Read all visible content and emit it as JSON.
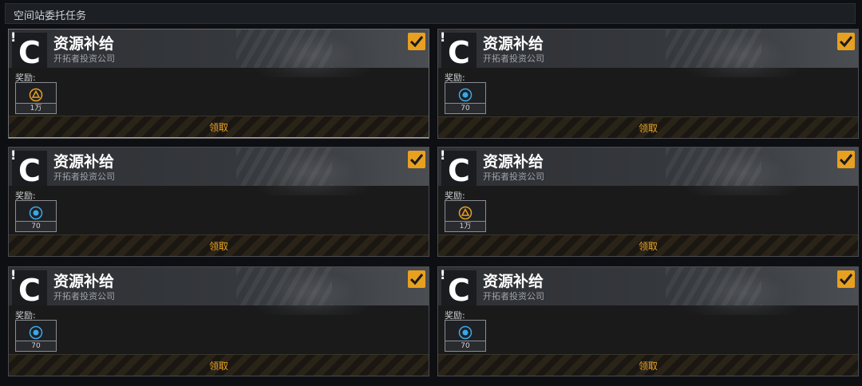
{
  "window": {
    "title": "空间站委托任务"
  },
  "cards": [
    {
      "rank": "C",
      "name": "资源补给",
      "company": "开拓者投资公司",
      "reward_label": "奖励:",
      "reward_icon": "gold-triangle-icon",
      "reward_qty": "1万",
      "claim_label": "领取",
      "checked": true
    },
    {
      "rank": "C",
      "name": "资源补给",
      "company": "开拓者投资公司",
      "reward_label": "奖励:",
      "reward_icon": "blue-orb-icon",
      "reward_qty": "70",
      "claim_label": "领取",
      "checked": true
    },
    {
      "rank": "C",
      "name": "资源补给",
      "company": "开拓者投资公司",
      "reward_label": "奖励:",
      "reward_icon": "blue-orb-icon",
      "reward_qty": "70",
      "claim_label": "领取",
      "checked": true
    },
    {
      "rank": "C",
      "name": "资源补给",
      "company": "开拓者投资公司",
      "reward_label": "奖励:",
      "reward_icon": "gold-triangle-icon",
      "reward_qty": "1万",
      "claim_label": "领取",
      "checked": true
    },
    {
      "rank": "C",
      "name": "资源补给",
      "company": "开拓者投资公司",
      "reward_label": "奖励:",
      "reward_icon": "blue-orb-icon",
      "reward_qty": "70",
      "claim_label": "领取",
      "checked": true
    },
    {
      "rank": "C",
      "name": "资源补给",
      "company": "开拓者投资公司",
      "reward_label": "奖励:",
      "reward_icon": "blue-orb-icon",
      "reward_qty": "70",
      "claim_label": "领取",
      "checked": true
    }
  ],
  "colors": {
    "accent": "#e8a020",
    "blue": "#3aa8e8",
    "panel": "#1a1a1a"
  }
}
